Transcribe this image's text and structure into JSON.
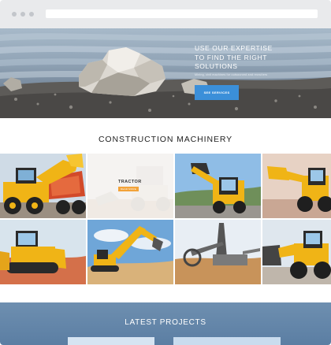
{
  "hero": {
    "headline_line1": "USE OUR EXPERTISE",
    "headline_line2": "TO FIND THE RIGHT",
    "headline_line3": "SOLUTIONS",
    "subtext": "Mining, civil machines for outsourced and recruiters",
    "button_label": "SEE SERVICES"
  },
  "machinery": {
    "title": "CONSTRUCTION MACHINERY",
    "hover_label": "TRACTOR",
    "hover_button": "READ MORE",
    "tiles": [
      {
        "icon": "dump-truck-excavator-image"
      },
      {
        "icon": "tractor-image"
      },
      {
        "icon": "skid-steer-loader-image"
      },
      {
        "icon": "backhoe-loader-image"
      },
      {
        "icon": "bulldozer-image"
      },
      {
        "icon": "excavator-image"
      },
      {
        "icon": "bucket-wheel-excavator-image"
      },
      {
        "icon": "wheel-loader-image"
      }
    ]
  },
  "latest": {
    "title": "LATEST PROJECTS"
  },
  "colors": {
    "accent_blue": "#3b8fd9",
    "machine_yellow": "#f0b416",
    "hover_orange": "#f2a33a"
  }
}
